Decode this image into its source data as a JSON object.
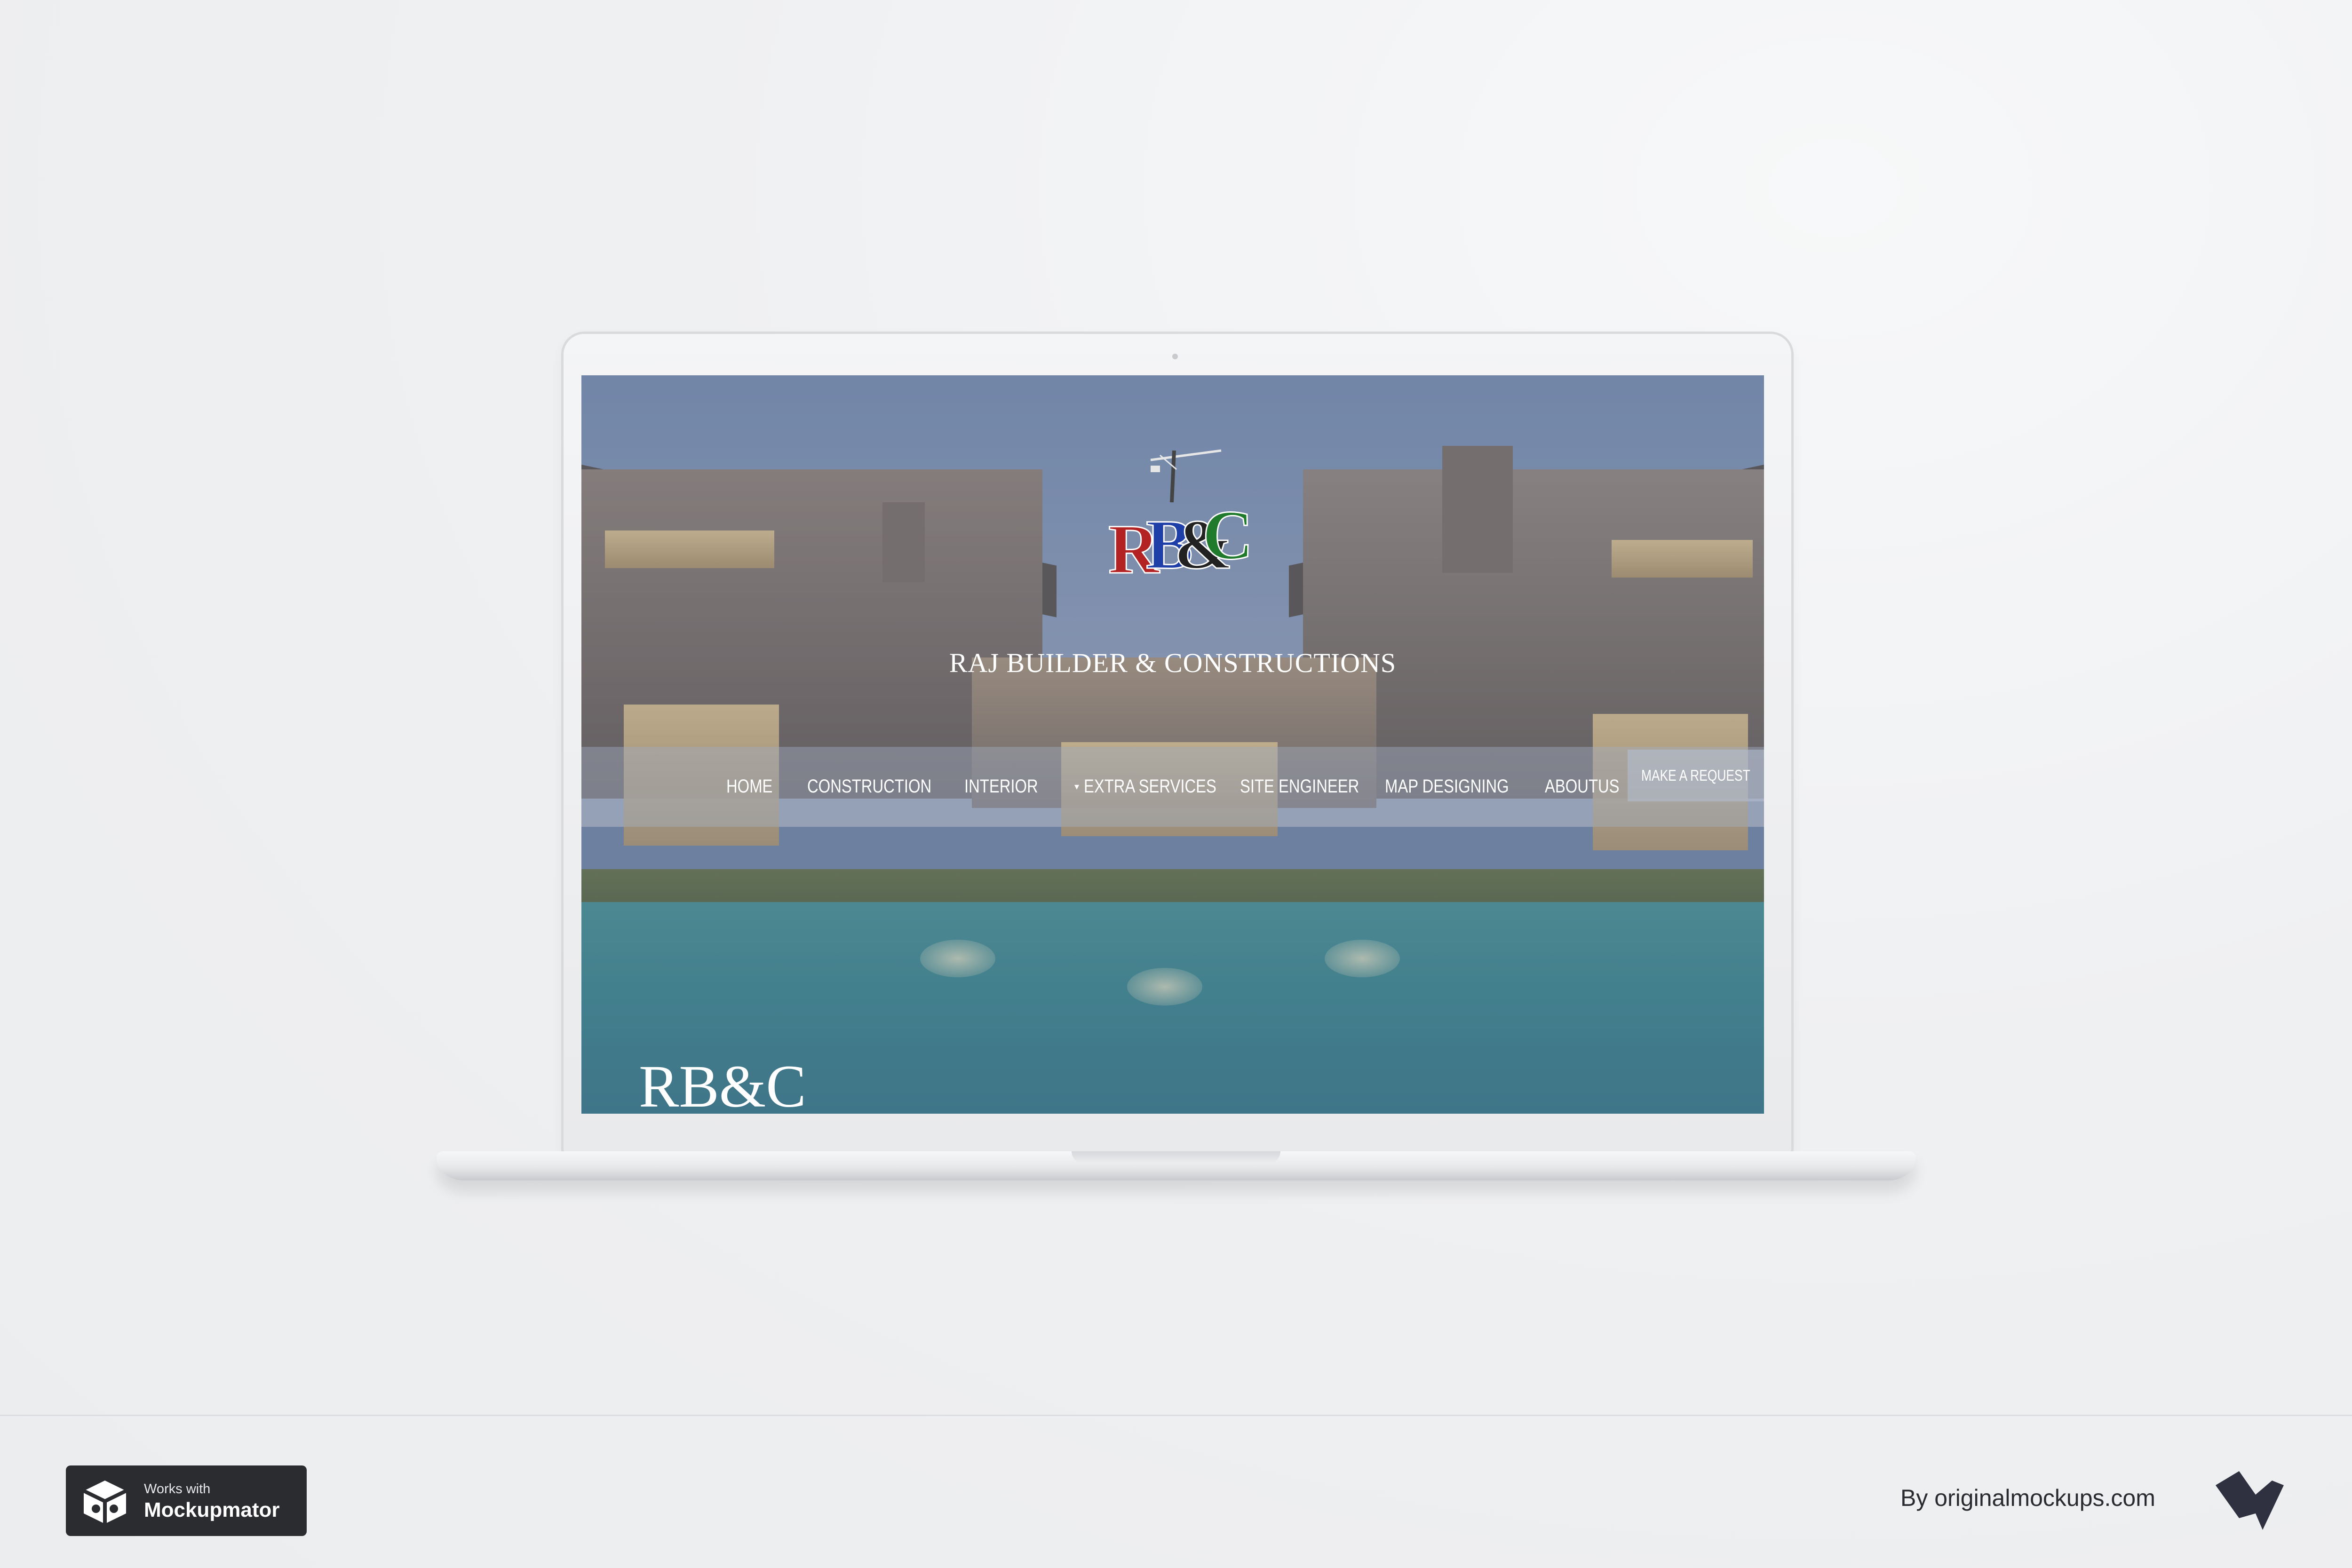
{
  "website": {
    "logo_text": "RB&C",
    "site_title": "RAJ BUILDER & CONSTRUCTIONS",
    "nav": {
      "items": [
        {
          "label": "HOME"
        },
        {
          "label": "CONSTRUCTION"
        },
        {
          "label": "INTERIOR"
        },
        {
          "label": "EXTRA SERVICES"
        },
        {
          "label": "SITE ENGINEER"
        },
        {
          "label": "MAP DESIGNING"
        },
        {
          "label": "ABOUTUS"
        }
      ],
      "cta_label": "MAKE A REQUEST"
    },
    "hero_brand": "RB&C"
  },
  "footer": {
    "badge_small": "Works with",
    "badge_big": "Mockupmator",
    "credit": "By originalmockups.com"
  },
  "colors": {
    "background": "#eeeff1",
    "badge": "#2b2c30",
    "text_dark": "#2a2b30",
    "nav_text": "#ffffff"
  }
}
